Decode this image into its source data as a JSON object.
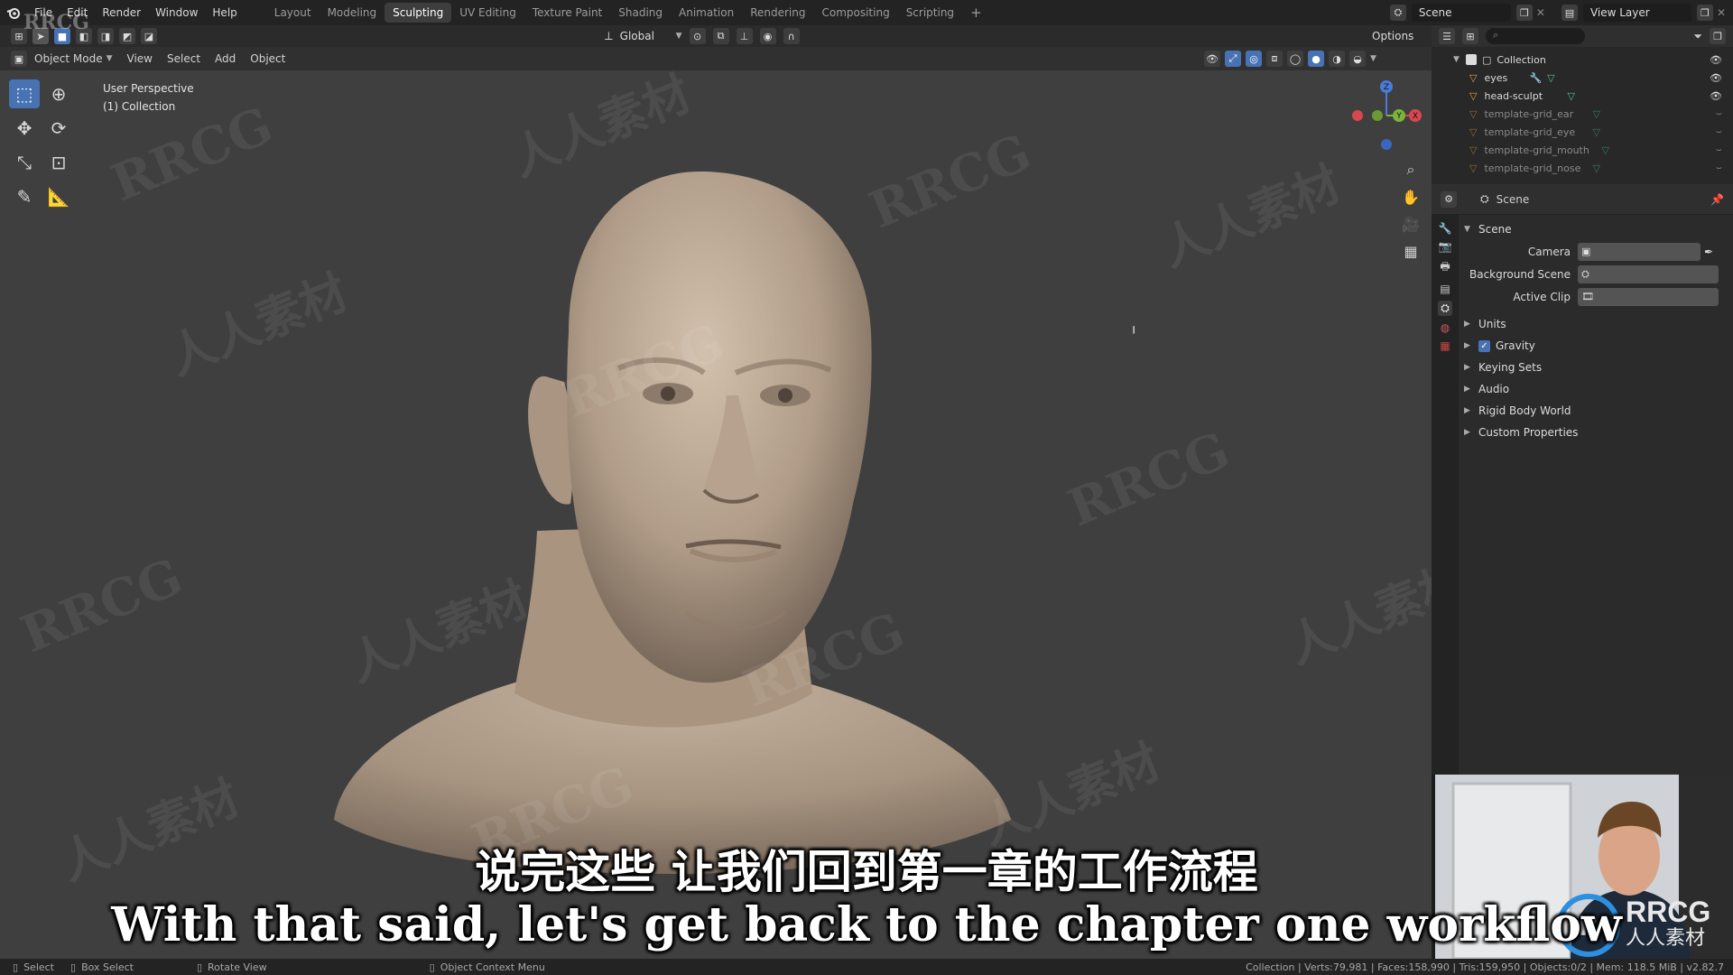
{
  "menu": {
    "items": [
      "File",
      "Edit",
      "Render",
      "Window",
      "Help"
    ],
    "workspaces": [
      "Layout",
      "Modeling",
      "Sculpting",
      "UV Editing",
      "Texture Paint",
      "Shading",
      "Animation",
      "Rendering",
      "Compositing",
      "Scripting"
    ],
    "active_workspace": "Sculpting",
    "add_tab": "+",
    "scene_name": "Scene",
    "view_layer": "View Layer"
  },
  "toolbar": {
    "orientation": "Global",
    "options": "Options"
  },
  "viewport_header": {
    "mode": "Object Mode",
    "menus": [
      "View",
      "Select",
      "Add",
      "Object"
    ]
  },
  "viewport": {
    "perspective": "User Perspective",
    "collection": "(1) Collection",
    "gizmo": {
      "z": "Z",
      "y": "Y",
      "x": "X"
    }
  },
  "outliner": {
    "collection": "Collection",
    "items": [
      {
        "name": "eyes",
        "dim": false
      },
      {
        "name": "head-sculpt",
        "dim": false
      },
      {
        "name": "template-grid_ear",
        "dim": true
      },
      {
        "name": "template-grid_eye",
        "dim": true
      },
      {
        "name": "template-grid_mouth",
        "dim": true
      },
      {
        "name": "template-grid_nose",
        "dim": true
      }
    ]
  },
  "properties": {
    "header": "Scene",
    "section": "Scene",
    "camera_label": "Camera",
    "background_label": "Background Scene",
    "active_clip_label": "Active Clip",
    "panels": [
      "Units",
      "Gravity",
      "Keying Sets",
      "Audio",
      "Rigid Body World",
      "Custom Properties"
    ],
    "gravity_checked": true
  },
  "status": {
    "select": "Select",
    "box_select": "Box Select",
    "rotate": "Rotate View",
    "context": "Object Context Menu",
    "stats": "Collection | Verts:79,981 | Faces:158,990 | Tris:159,950 | Objects:0/2 | Mem: 118.5 MiB | v2.82.7"
  },
  "subtitles": {
    "chinese": "说完这些 让我们回到第一章的工作流程",
    "english": "With that said, let's get back to the chapter one workflow"
  },
  "watermark": {
    "logo_text": "RRCG",
    "logo_sub": "人人素材",
    "corner": "RRCG"
  },
  "colors": {
    "accent": "#4772b3",
    "viewport_bg": "#3f3f3f",
    "skin": "#b8a593"
  }
}
